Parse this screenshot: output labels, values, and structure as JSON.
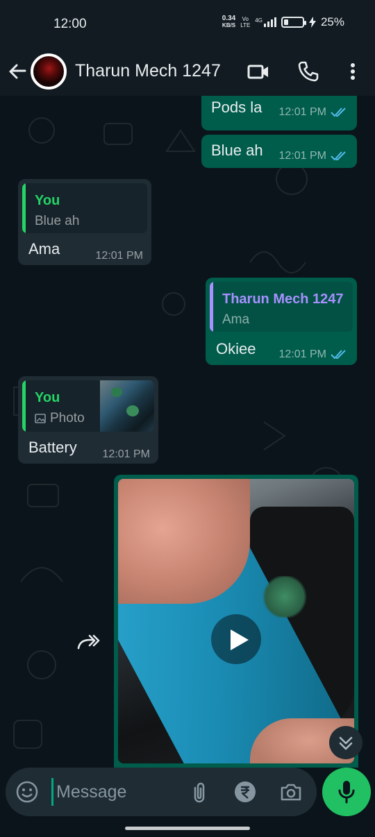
{
  "status_bar": {
    "time": "12:00",
    "net_speed_value": "0.34",
    "net_speed_unit": "KB/S",
    "vo_top": "Vo",
    "vo_bottom": "LTE",
    "network": "4G",
    "battery_percent_text": "25%",
    "battery_level": 0.25
  },
  "header": {
    "contact_name": "Tharun Mech 1247",
    "icons": [
      "back-arrow-icon",
      "video-call-icon",
      "phone-icon",
      "more-vert-icon"
    ]
  },
  "messages": [
    {
      "direction": "out",
      "text": "Pods la",
      "time": "12:01 PM",
      "status": "read"
    },
    {
      "direction": "out",
      "text": "Blue ah",
      "time": "12:01 PM",
      "status": "read"
    },
    {
      "direction": "in",
      "quote_author": "You",
      "quote_text": "Blue ah",
      "text": "Ama",
      "time": "12:01 PM"
    },
    {
      "direction": "out",
      "quote_author": "Tharun Mech 1247",
      "quote_text": "Ama",
      "text": "Okiee",
      "time": "12:01 PM",
      "status": "read"
    },
    {
      "direction": "in",
      "quote_author": "You",
      "quote_text": "Photo",
      "quote_icon": "image-icon",
      "text": "Battery",
      "time": "12:01 PM"
    },
    {
      "direction": "out",
      "type": "video",
      "icon": "play-icon"
    }
  ],
  "composer": {
    "placeholder": "Message",
    "icons": [
      "emoji-icon",
      "attach-icon",
      "rupee-payment-icon",
      "camera-icon",
      "mic-icon"
    ]
  },
  "colors": {
    "header_bg": "#111b21",
    "chat_bg": "#0b141a",
    "outgoing_bubble": "#005c4b",
    "incoming_bubble": "#1f2c34",
    "read_tick": "#53bdeb",
    "you_quote": "#25d366",
    "contact_quote": "#a791ff",
    "mic_button": "#21c063"
  }
}
